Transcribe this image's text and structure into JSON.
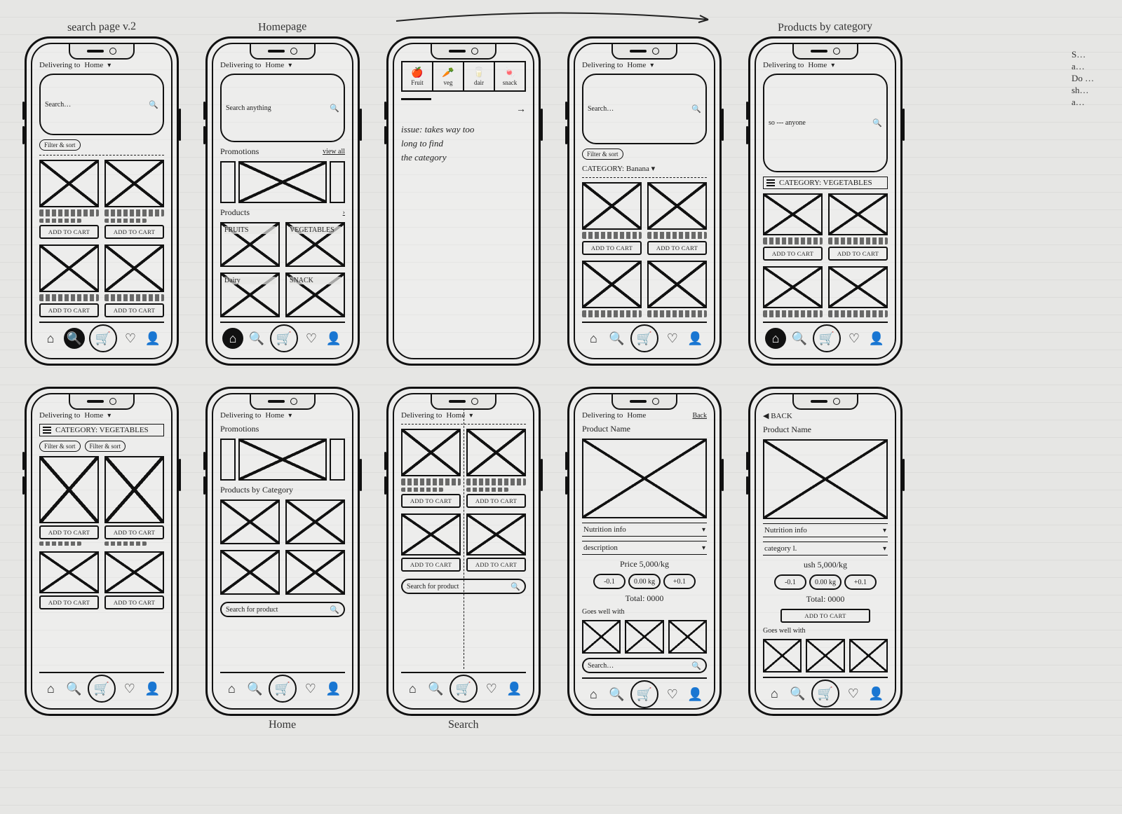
{
  "captions": {
    "top": [
      "search page v.2",
      "Homepage",
      "→",
      "",
      "Products by category"
    ],
    "bottom": [
      "",
      "Home",
      "Search",
      "",
      ""
    ]
  },
  "sidenote_lines": [
    "S…",
    "a…",
    "Do …",
    "sh…",
    "a…"
  ],
  "header": {
    "delivering_to": "Delivering to",
    "location": "Home",
    "back": "◀ BACK",
    "back_word": "Back"
  },
  "search": {
    "placeholder_anything": "Search anything",
    "placeholder_generic": "Search…",
    "placeholder_also": "so --- anyone",
    "placeholder_product": "Search for product",
    "filter": "Filter & sort",
    "category_dropdown": "CATEGORY: Banana ▾",
    "category_bar": "CATEGORY: VEGETABLES",
    "category_bar2": "CATEGORY: VEGETABLES"
  },
  "labels": {
    "add_to_cart": "ADD TO CART",
    "promotions": "Promotions",
    "view_all": "view all",
    "products": "Products",
    "products_by_category": "Products by Category",
    "product_name": "Product Name",
    "nutrition_info": "Nutrition info",
    "description": "description",
    "category_l": "category l.",
    "goes_well_with": "Goes well with",
    "total": "Total: 0000",
    "total2": "Total: 0000",
    "price": "Price 5,000/kg",
    "price2": "ush 5,000/kg",
    "issue_line1": "issue: takes way too",
    "issue_line2": "long to find",
    "issue_line3": "the category"
  },
  "stepper": {
    "minus": "-0.1",
    "val": "0.00 kg",
    "plus": "+0.1"
  },
  "category_tiles": [
    "FRUITS",
    "VEGETABLES",
    "Dairy",
    "SNACK"
  ],
  "top_tabs": [
    {
      "icon": "🍎",
      "label": "Fruit"
    },
    {
      "icon": "🥕",
      "label": "veg"
    },
    {
      "icon": "🥛",
      "label": "dair"
    },
    {
      "icon": "🍬",
      "label": "snack"
    }
  ],
  "tabbar_icons": {
    "home": "⌂",
    "search": "🔍",
    "cart": "🛒",
    "fav": "♡",
    "profile": "👤"
  }
}
